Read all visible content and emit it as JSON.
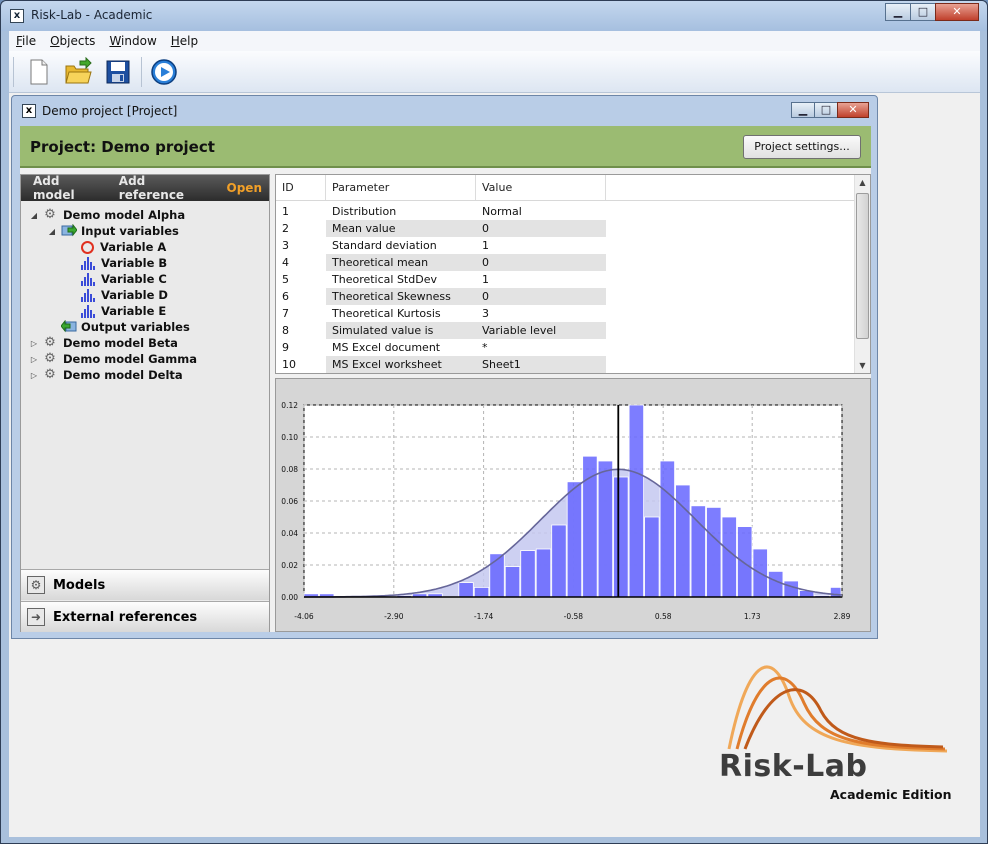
{
  "window": {
    "title": "Risk-Lab - Academic",
    "minimize": "▁",
    "maximize": "□",
    "close": "✕"
  },
  "menu": [
    {
      "label": "File",
      "underline": "F",
      "rest": "ile"
    },
    {
      "label": "Objects",
      "underline": "O",
      "rest": "bjects"
    },
    {
      "label": "Window",
      "underline": "W",
      "rest": "indow"
    },
    {
      "label": "Help",
      "underline": "H",
      "rest": "elp"
    }
  ],
  "toolbar": {
    "icons": [
      "new-document-icon",
      "open-folder-icon",
      "save-disk-icon",
      "run-play-icon"
    ]
  },
  "child": {
    "title": "Demo project [Project]"
  },
  "project": {
    "title": "Project: Demo project",
    "settings_label": "Project settings..."
  },
  "left_tabs": {
    "add_model": "Add model",
    "add_reference": "Add reference",
    "open": "Open"
  },
  "tree": {
    "model_alpha": "Demo model Alpha",
    "input_variables": "Input variables",
    "var_a": "Variable A",
    "var_b": "Variable B",
    "var_c": "Variable C",
    "var_d": "Variable D",
    "var_e": "Variable E",
    "output_variables": "Output variables",
    "model_beta": "Demo model Beta",
    "model_gamma": "Demo model Gamma",
    "model_delta": "Demo model Delta"
  },
  "bottom": {
    "models": "Models",
    "external": "External references"
  },
  "params": {
    "headers": {
      "id": "ID",
      "parameter": "Parameter",
      "value": "Value"
    },
    "rows": [
      {
        "id": "1",
        "parameter": "Distribution",
        "value": "Normal"
      },
      {
        "id": "2",
        "parameter": "Mean value",
        "value": "0"
      },
      {
        "id": "3",
        "parameter": "Standard deviation",
        "value": "1"
      },
      {
        "id": "4",
        "parameter": "Theoretical mean",
        "value": "0"
      },
      {
        "id": "5",
        "parameter": "Theoretical StdDev",
        "value": "1"
      },
      {
        "id": "6",
        "parameter": "Theoretical Skewness",
        "value": "0"
      },
      {
        "id": "7",
        "parameter": "Theoretical Kurtosis",
        "value": "3"
      },
      {
        "id": "8",
        "parameter": "Simulated value is",
        "value": "Variable level"
      },
      {
        "id": "9",
        "parameter": "MS Excel document",
        "value": "*"
      },
      {
        "id": "10",
        "parameter": "MS Excel worksheet",
        "value": "Sheet1"
      }
    ]
  },
  "chart_data": {
    "type": "bar",
    "x_tick_labels": [
      "-4.06",
      "-2.90",
      "-1.74",
      "-0.58",
      "0.58",
      "1.73",
      "2.89"
    ],
    "y_tick_labels": [
      "0.00",
      "0.02",
      "0.04",
      "0.06",
      "0.08",
      "0.10",
      "0.12"
    ],
    "xlim": [
      -4.06,
      2.89
    ],
    "ylim": [
      0,
      0.12
    ],
    "bin_width": 0.2,
    "bin_starts": [
      -4.06,
      -3.86,
      -3.66,
      -3.46,
      -3.26,
      -3.06,
      -2.86,
      -2.66,
      -2.46,
      -2.26,
      -2.06,
      -1.86,
      -1.66,
      -1.46,
      -1.26,
      -1.06,
      -0.86,
      -0.66,
      -0.46,
      -0.26,
      -0.06,
      0.14,
      0.34,
      0.54,
      0.74,
      0.94,
      1.14,
      1.34,
      1.54,
      1.74,
      1.94,
      2.14,
      2.34,
      2.54,
      2.74
    ],
    "values": [
      0.002,
      0.002,
      0,
      0,
      0.001,
      0,
      0.001,
      0.002,
      0.002,
      0,
      0.009,
      0.006,
      0.027,
      0.019,
      0.029,
      0.03,
      0.045,
      0.072,
      0.088,
      0.085,
      0.075,
      0.12,
      0.05,
      0.085,
      0.07,
      0.057,
      0.056,
      0.05,
      0.044,
      0.03,
      0.016,
      0.01,
      0.004,
      0.001,
      0.006
    ],
    "overlay": "normal density curve (mean 0, std dev 1)",
    "mean_line_x": 0,
    "grid": true,
    "colors": {
      "bars": "#6666ff",
      "curve_fill": "#c4c8f0",
      "curve_line": "#666699"
    }
  },
  "logo": {
    "name": "Risk-Lab",
    "edition": "Academic Edition"
  }
}
